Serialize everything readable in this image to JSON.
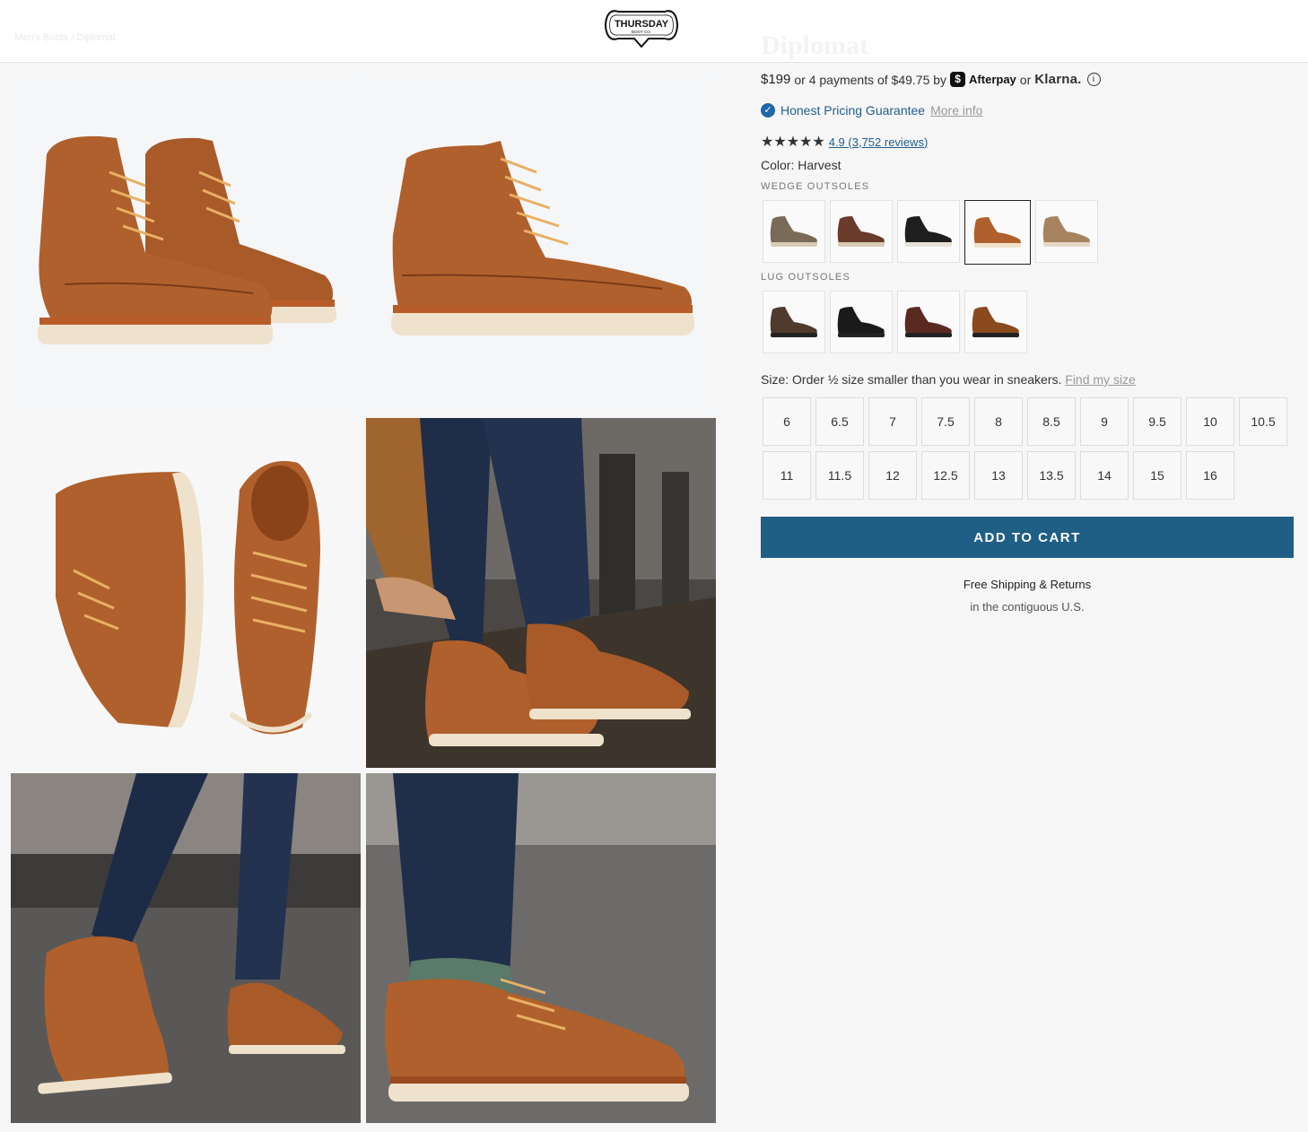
{
  "header": {
    "breadcrumb": "Men's Boots / Diplomat",
    "logo_text_top": "THURSDAY",
    "logo_text_bottom": "BOOT CO."
  },
  "product": {
    "title": "Diplomat",
    "price": "$199",
    "installments_text": "or 4 payments of $49.75 by",
    "afterpay_badge": "$",
    "afterpay_label": "Afterpay",
    "or_text": "or",
    "klarna_label": "Klarna.",
    "info_icon": "i",
    "guarantee_label": "Honest Pricing Guarantee",
    "guarantee_link": "More info",
    "stars": "★★★★★",
    "rating_count": 5,
    "reviews_link": "4.9 (3,752 reviews)",
    "color_label": "Color: Harvest",
    "wedge_label": "WEDGE OUTSOLES",
    "lug_label": "LUG OUTSOLES",
    "wedge_swatches": [
      {
        "color": "#7a6a58",
        "sole": "#d8cbb4"
      },
      {
        "color": "#6a3a2a",
        "sole": "#d8cbb4"
      },
      {
        "color": "#1e1e1e",
        "sole": "#e8e2d6"
      },
      {
        "color": "#b0602c",
        "sole": "#efe2cc"
      },
      {
        "color": "#a8835f",
        "sole": "#e6dac6"
      }
    ],
    "selected_wedge_index": 3,
    "lug_swatches": [
      {
        "color": "#4f3b2e"
      },
      {
        "color": "#1a1a1a"
      },
      {
        "color": "#5a2a22"
      },
      {
        "color": "#8a4a1e"
      }
    ],
    "size_label_text": "Size: Order ½ size smaller than you wear in sneakers.",
    "find_size_link": "Find my size",
    "sizes_row1": [
      "6",
      "6.5",
      "7",
      "7.5",
      "8",
      "8.5",
      "9",
      "9.5",
      "10",
      "10.5"
    ],
    "sizes_row2": [
      "11",
      "11.5",
      "12",
      "12.5",
      "13",
      "13.5",
      "14",
      "15",
      "16"
    ],
    "add_to_cart": "ADD TO CART",
    "shipping_title": "Free Shipping & Returns",
    "shipping_sub": "in the contiguous U.S."
  },
  "colors": {
    "accent": "#1f5e85",
    "link": "#1f5e8a",
    "boot_leather": "#b0602c",
    "sole": "#efe2cc"
  },
  "gallery": {
    "images": [
      "boot-pair-angle-image",
      "boot-side-profile-image",
      "boot-top-down-image",
      "lifestyle-lacing-image",
      "lifestyle-walking-image",
      "lifestyle-standing-image"
    ]
  }
}
